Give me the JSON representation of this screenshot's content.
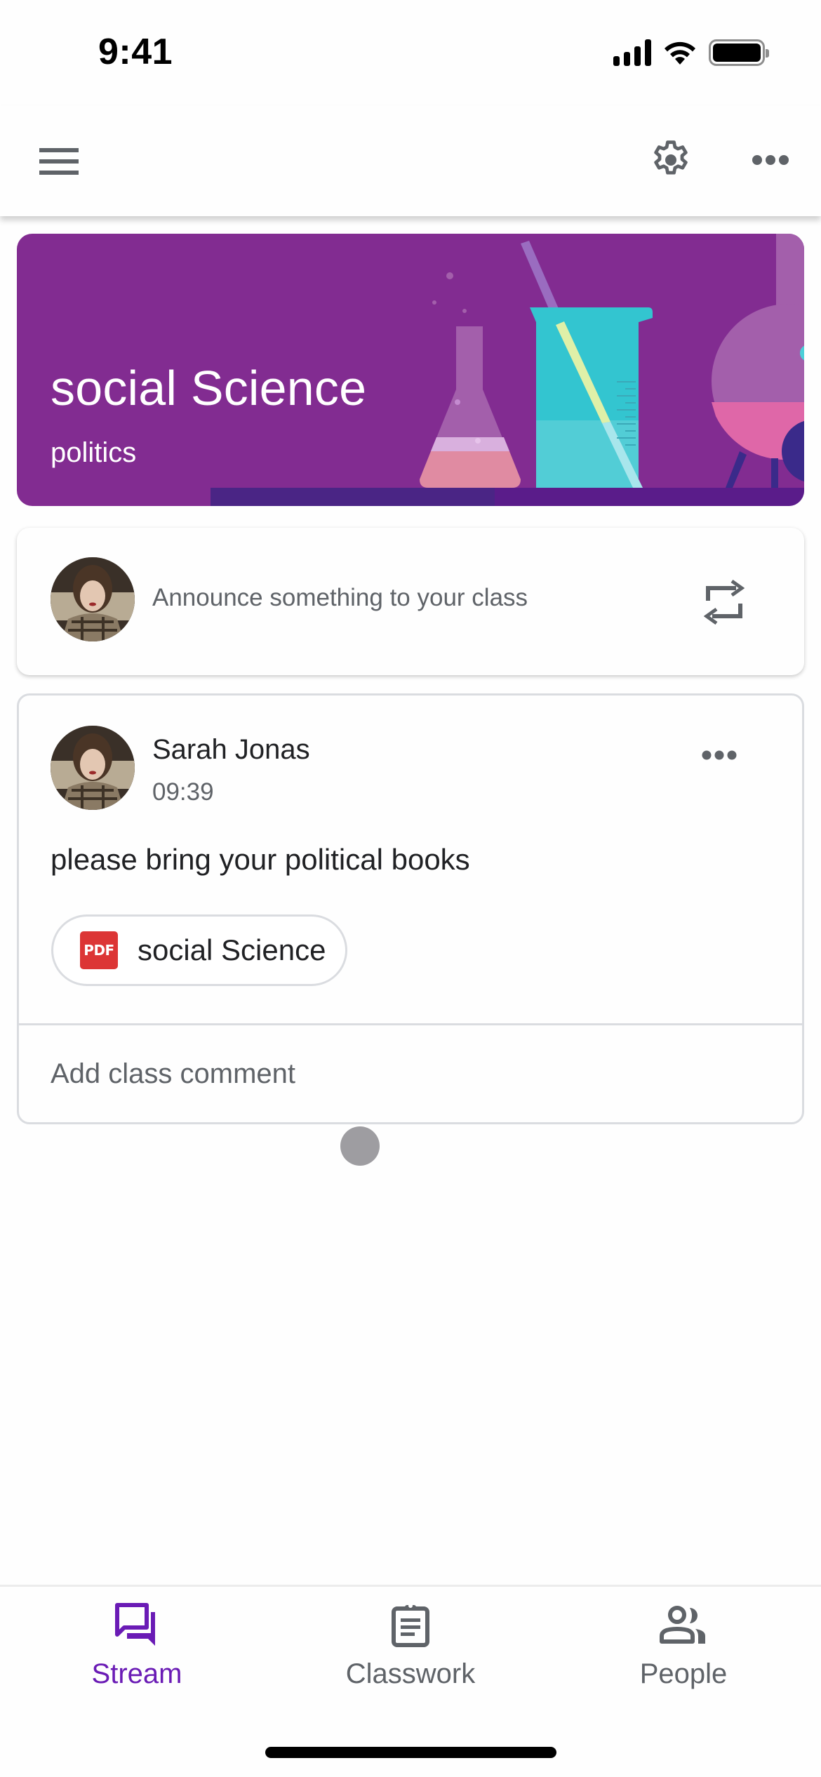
{
  "status_bar": {
    "time": "9:41",
    "icons": [
      "cellular-signal-icon",
      "wifi-icon",
      "battery-icon"
    ]
  },
  "app_bar": {
    "menu_icon": "hamburger-menu-icon",
    "settings_icon": "gear-icon",
    "more_icon": "more-horizontal-icon"
  },
  "banner": {
    "title": "social Science",
    "subtitle": "politics",
    "theme_color": "#822c91",
    "illustration": "science-lab-glassware"
  },
  "announce": {
    "placeholder": "Announce something to your class",
    "repost_icon": "repost-icon"
  },
  "post": {
    "author": "Sarah Jonas",
    "time": "09:39",
    "body": "please bring your political books",
    "attachment": {
      "type_label": "PDF",
      "name": "social Science",
      "icon_color": "#dc3535"
    },
    "comment_placeholder": "Add class comment"
  },
  "bottom_nav": {
    "active_color": "#6a1bb5",
    "items": [
      {
        "label": "Stream",
        "icon": "stream-icon",
        "active": true
      },
      {
        "label": "Classwork",
        "icon": "clipboard-icon",
        "active": false
      },
      {
        "label": "People",
        "icon": "people-icon",
        "active": false
      }
    ]
  }
}
